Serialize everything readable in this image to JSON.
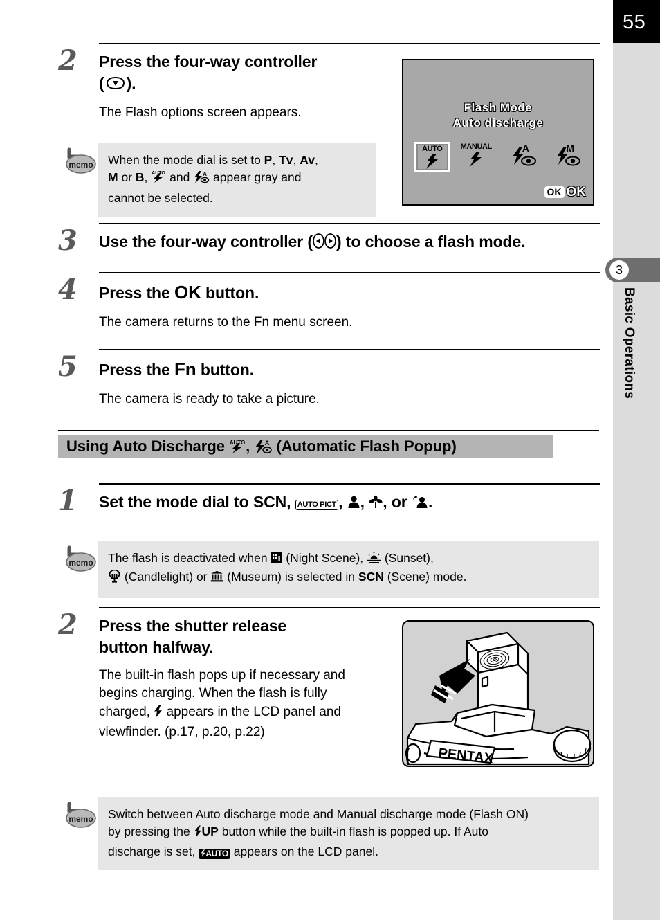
{
  "page": {
    "number": "55",
    "chapter_number": "3",
    "chapter_title": "Basic Operations"
  },
  "steps_part1": [
    {
      "num": "2",
      "heading_line1": "Press the four-way controller",
      "heading_line2": "(",
      "heading_line2_suffix": ").",
      "controller_icon": "four-way-down-icon",
      "desc": "The Flash options screen appears."
    },
    {
      "num": "3",
      "heading_prefix": "Use the four-way controller (",
      "heading_suffix": ") to choose a flash mode.",
      "controller_icons": [
        "four-way-left-icon",
        "four-way-right-icon"
      ]
    },
    {
      "num": "4",
      "heading_prefix": "Press the ",
      "heading_button": "OK",
      "heading_suffix": " button.",
      "desc": "The camera returns to the Fn menu screen."
    },
    {
      "num": "5",
      "heading_prefix": "Press the ",
      "heading_button": "Fn",
      "heading_suffix": " button.",
      "desc": "The camera is ready to take a picture."
    }
  ],
  "memo1": {
    "icon": "memo-icon",
    "line1_a": "When the mode dial is set to ",
    "mode_p": "P",
    "sep1": ", ",
    "mode_tv": "Tv",
    "sep2": ", ",
    "mode_av": "Av",
    "sep3": ",",
    "line2_a": "",
    "mode_m": "M",
    "line2_or": " or ",
    "mode_b": "B",
    "line2_comma": ", ",
    "icon_auto": "flash-auto-icon",
    "line2_and": " and ",
    "icon_redeye_a": "flash-auto-redeye-icon",
    "line2_b": " appear gray and",
    "line3": "cannot be selected."
  },
  "section_header": {
    "prefix": "Using Auto Discharge ",
    "icon1": "flash-auto-icon",
    "sep": ", ",
    "icon2": "flash-auto-redeye-icon",
    "suffix": " (Automatic Flash Popup)"
  },
  "steps_part2": [
    {
      "num": "1",
      "heading_prefix": "Set the mode dial to ",
      "mode_scn": "SCN",
      "sep1": ", ",
      "mode_autopict": "AUTO PICT",
      "sep2": ", ",
      "icon_portrait": "portrait-mode-icon",
      "sep3": ", ",
      "icon_macro": "macro-mode-icon",
      "sep4": ", or ",
      "icon_nightportrait": "night-portrait-mode-icon",
      "suffix": "."
    },
    {
      "num": "2",
      "heading_line1": "Press the shutter release",
      "heading_line2": "button halfway.",
      "desc_a": "The built-in flash pops up if necessary and begins charging. When the flash is fully charged, ",
      "desc_icon": "flash-bolt-icon",
      "desc_b": " appears in the LCD panel and viewfinder. (p.17, p.20, p.22)"
    }
  ],
  "memo2": {
    "icon": "memo-icon",
    "line1_a": "The flash is deactivated when ",
    "icon_night": "night-scene-icon",
    "line1_b": " (Night Scene), ",
    "icon_sunset": "sunset-icon",
    "line1_c": " (Sunset),",
    "line2_icon_candle": "candlelight-icon",
    "line2_a": " (Candlelight) or ",
    "line2_icon_museum": "museum-icon",
    "line2_b": " (Museum) is selected in ",
    "mode_scn": "SCN",
    "line2_c": " (Scene) mode."
  },
  "memo3": {
    "icon": "memo-icon",
    "line1": "Switch between Auto discharge mode and Manual discharge mode (Flash ON)",
    "line2_a": "by pressing the ",
    "button_flash_up": "UP",
    "line2_b": " button while the built-in flash is popped up. If Auto",
    "line3_a": "discharge is set, ",
    "lcd_auto_badge": "AUTO",
    "line3_b": " appears on the LCD panel."
  },
  "lcd_figure": {
    "title_line1": "Flash Mode",
    "title_line2": "Auto discharge",
    "icons": [
      {
        "name": "flash-auto-option",
        "label": "AUTO",
        "selected": true
      },
      {
        "name": "flash-manual-option",
        "label": "MANUAL",
        "selected": false
      },
      {
        "name": "flash-auto-redeye-option",
        "label": "A",
        "selected": false
      },
      {
        "name": "flash-manual-redeye-option",
        "label": "M",
        "selected": false
      }
    ],
    "ok_button": "OK",
    "ok_label": "OK"
  },
  "camera_figure": {
    "brand": "PENTAX",
    "description": "camera-with-popup-flash-illustration"
  },
  "colors": {
    "page_tab_bg": "#dcdcdc",
    "page_number_bg": "#000000",
    "chapter_tab_bg": "#6e6e6e",
    "memo_bg": "#e6e6e6",
    "section_header_bg": "#b4b4b4",
    "lcd_bg": "#a8a8a8",
    "camera_fig_bg": "#d2d2d2",
    "step_number_color": "#5a5a5a"
  }
}
